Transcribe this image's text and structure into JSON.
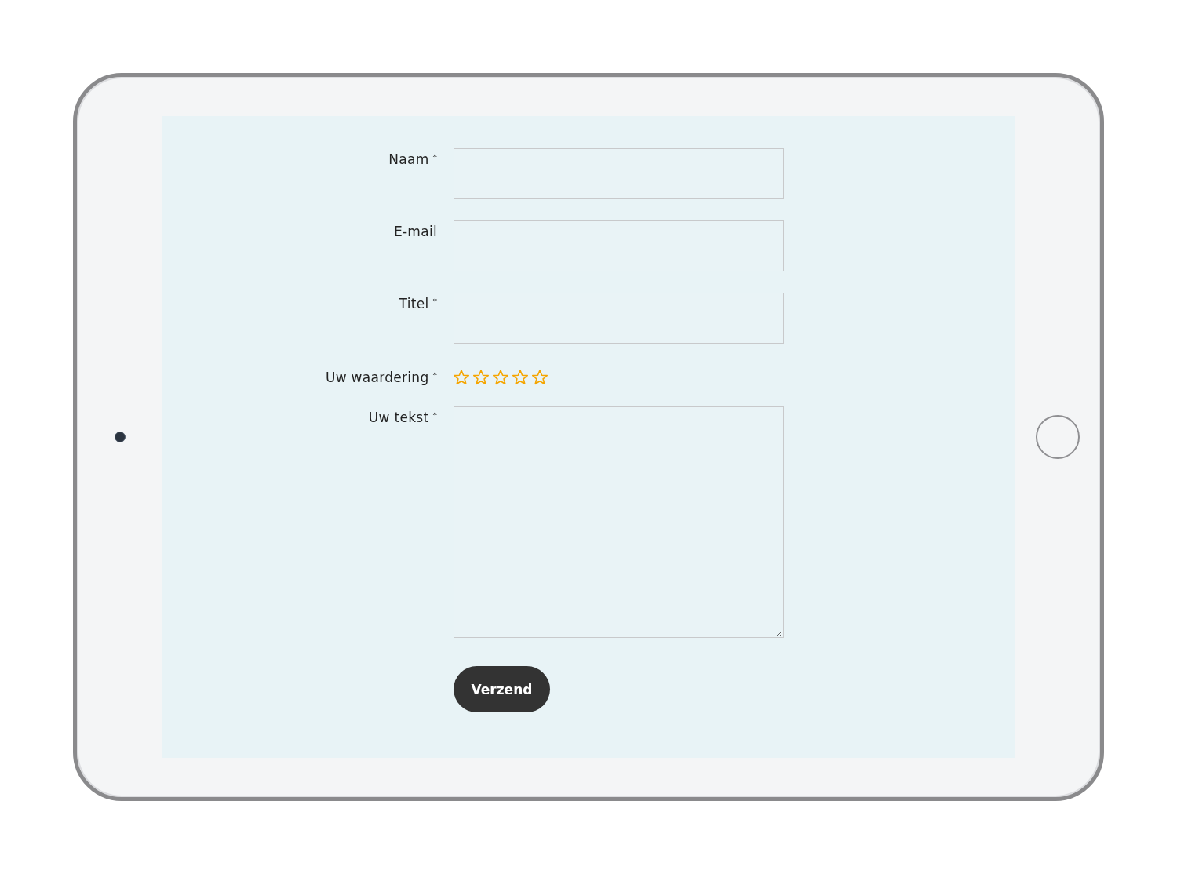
{
  "form": {
    "fields": [
      {
        "kind": "input",
        "label": "Naam",
        "required_mark": "*"
      },
      {
        "kind": "input",
        "label": "E-mail"
      },
      {
        "kind": "input",
        "label": "Titel",
        "required_mark": "*"
      },
      {
        "kind": "rating",
        "label": "Uw waardering",
        "required_mark": "*",
        "stars": 0
      },
      {
        "kind": "textarea",
        "label": "Uw tekst",
        "required_mark": "*"
      }
    ],
    "submit": "Verzend"
  }
}
